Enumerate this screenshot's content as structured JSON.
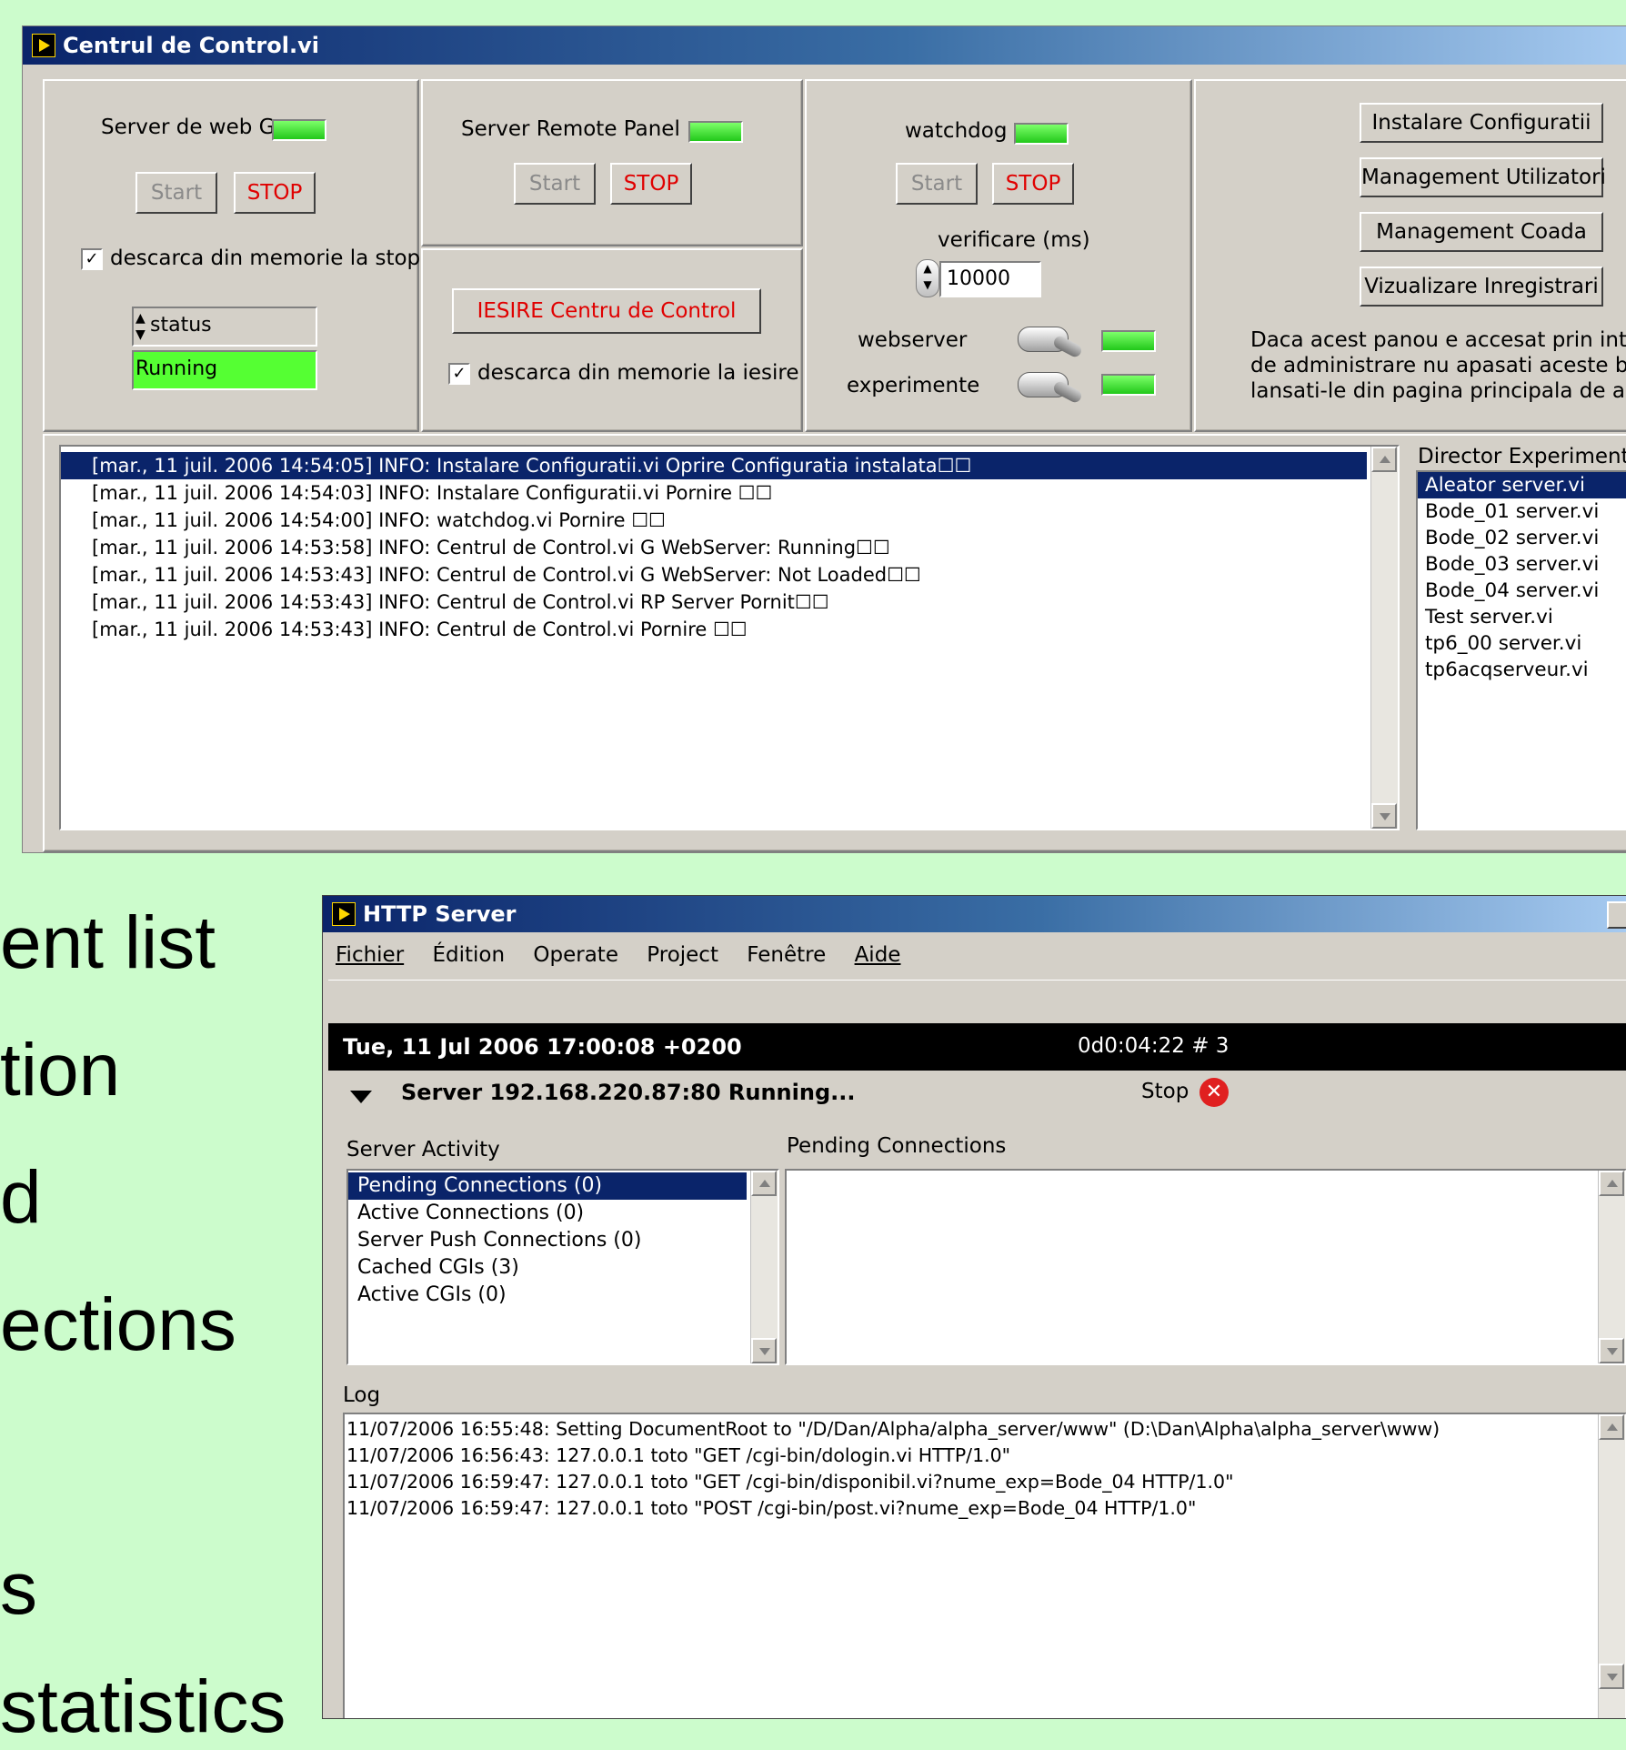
{
  "slide_fragments": [
    "ent list",
    "tion",
    "d",
    "ections",
    "",
    "s",
    "statistics"
  ],
  "control_window": {
    "title": "Centrul de Control.vi",
    "web_group": {
      "label": "Server de web G",
      "start": "Start",
      "stop": "STOP",
      "unload_label": "descarca din memorie la stop",
      "unload_checked": "✓",
      "status_label": "status",
      "status_value": "Running"
    },
    "rp_group": {
      "label": "Server Remote Panel",
      "start": "Start",
      "stop": "STOP"
    },
    "exit_group": {
      "exit_button": "IESIRE Centru de Control",
      "unload_label": "descarca din memorie la iesire",
      "unload_checked": "✓"
    },
    "watchdog_group": {
      "label": "watchdog",
      "start": "Start",
      "stop": "STOP",
      "interval_label": "verificare (ms)",
      "interval_value": "10000",
      "webserver_label": "webserver",
      "experiments_label": "experimente"
    },
    "admin_group": {
      "buttons": [
        "Instalare Configuratii",
        "Management Utilizatori",
        "Management Coada",
        "Vizualizare Inregistrari"
      ],
      "note": [
        "Daca acest panou e accesat prin interf",
        "de administrare nu apasati aceste buto",
        "lansati-le din pagina principala de admi"
      ]
    },
    "log_lines": [
      "[mar., 11 juil. 2006 14:54:05] INFO: Instalare Configuratii.vi Oprire Configuratia instalata☐☐",
      "[mar., 11 juil. 2006 14:54:03] INFO: Instalare Configuratii.vi Pornire ☐☐",
      "[mar., 11 juil. 2006 14:54:00] INFO: watchdog.vi Pornire ☐☐",
      "[mar., 11 juil. 2006 14:53:58] INFO: Centrul de Control.vi  G WebServer: Running☐☐",
      "[mar., 11 juil. 2006 14:53:43] INFO: Centrul de Control.vi  G WebServer: Not Loaded☐☐",
      "[mar., 11 juil. 2006 14:53:43] INFO: Centrul de Control.vi  RP Server Pornit☐☐",
      "[mar., 11 juil. 2006 14:53:43] INFO: Centrul de Control.vi Pornire ☐☐"
    ],
    "experiments": {
      "label": "Director Experimente",
      "items": [
        "Aleator server.vi",
        "Bode_01 server.vi",
        "Bode_02 server.vi",
        "Bode_03 server.vi",
        "Bode_04 server.vi",
        "Test server.vi",
        "tp6_00 server.vi",
        "tp6acqserveur.vi"
      ]
    }
  },
  "http_window": {
    "title": "HTTP Server",
    "menu": [
      "Fichier",
      "Édition",
      "Operate",
      "Project",
      "Fenêtre",
      "Aide"
    ],
    "datetime": "Tue, 11 Jul 2006 17:00:08 +0200",
    "uptime": "0d0:04:22 # 3",
    "server_status": "Server 192.168.220.87:80 Running...",
    "stop_label": "Stop",
    "activity_label": "Server Activity",
    "activity_items": [
      "Pending Connections (0)",
      "Active Connections (0)",
      "Server Push Connections (0)",
      "Cached CGIs (3)",
      "Active CGIs (0)"
    ],
    "pending_label": "Pending Connections",
    "log_label": "Log",
    "log_lines": [
      "11/07/2006 16:55:48: Setting DocumentRoot to \"/D/Dan/Alpha/alpha_server/www\" (D:\\Dan\\Alpha\\alpha_server\\www)",
      "11/07/2006 16:56:43: 127.0.0.1 toto \"GET /cgi-bin/dologin.vi HTTP/1.0\"",
      "11/07/2006 16:59:47: 127.0.0.1 toto \"GET /cgi-bin/disponibil.vi?nume_exp=Bode_04 HTTP/1.0\"",
      "11/07/2006 16:59:47: 127.0.0.1 toto \"POST /cgi-bin/post.vi?nume_exp=Bode_04 HTTP/1.0\""
    ]
  },
  "colors": {
    "background": "#ccfccc",
    "titlebar": "#0a246a",
    "selection": "#0a246a",
    "led_on": "#33dd22",
    "stop_text": "#e00000"
  }
}
